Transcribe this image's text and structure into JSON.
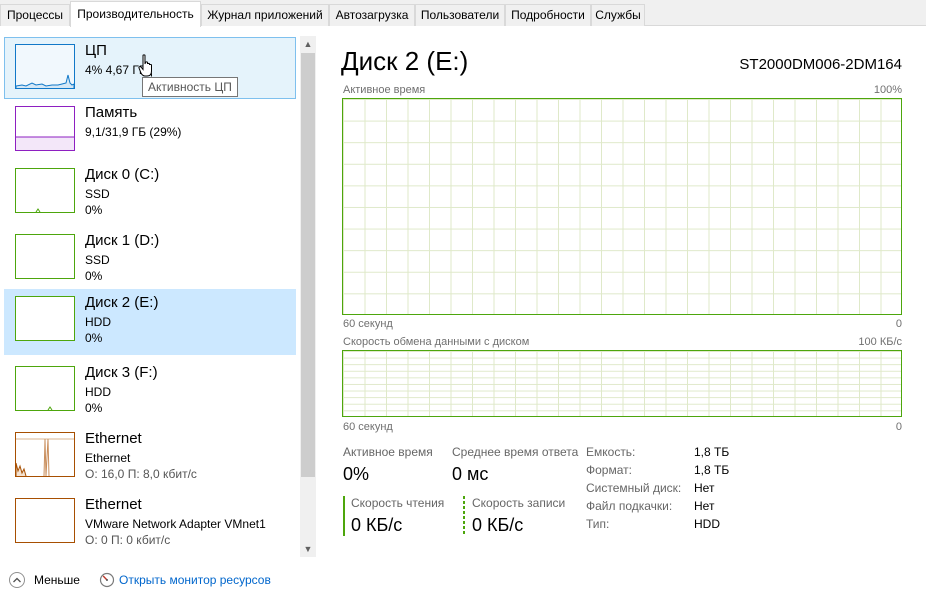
{
  "tabs": [
    "Процессы",
    "Производительность",
    "Журнал приложений",
    "Автозагрузка",
    "Пользователи",
    "Подробности",
    "Службы"
  ],
  "active_tab": "Производительность",
  "sidebar": {
    "items": [
      {
        "title": "ЦП",
        "line1": "4% 4,67 ГГц",
        "line2": "",
        "color": "#1178c8",
        "state": "hover"
      },
      {
        "title": "Память",
        "line1": "9,1/31,9 ГБ (29%)",
        "line2": "",
        "color": "#8e1fc1",
        "state": "normal"
      },
      {
        "title": "Диск 0 (C:)",
        "line1": "SSD",
        "line2": "0%",
        "color": "#4da60c",
        "state": "normal"
      },
      {
        "title": "Диск 1 (D:)",
        "line1": "SSD",
        "line2": "0%",
        "color": "#4da60c",
        "state": "normal"
      },
      {
        "title": "Диск 2 (E:)",
        "line1": "HDD",
        "line2": "0%",
        "color": "#4da60c",
        "state": "selected"
      },
      {
        "title": "Диск 3 (F:)",
        "line1": "HDD",
        "line2": "0%",
        "color": "#4da60c",
        "state": "normal"
      },
      {
        "title": "Ethernet",
        "line1": "Ethernet",
        "line2": "О: 16,0 П: 8,0 кбит/с",
        "color": "#a74f01",
        "state": "normal"
      },
      {
        "title": "Ethernet",
        "line1": "VMware Network Adapter VMnet1",
        "line2": "О: 0 П: 0 кбит/с",
        "color": "#a74f01",
        "state": "normal"
      }
    ]
  },
  "tooltip": "Активность ЦП",
  "main": {
    "title": "Диск 2 (E:)",
    "model": "ST2000DM006-2DM164",
    "graph1": {
      "label": "Активное время",
      "max": "100%",
      "time": "60 секунд",
      "min": "0"
    },
    "graph2": {
      "label": "Скорость обмена данными с диском",
      "max": "100 КБ/с",
      "time": "60 секунд",
      "min": "0"
    },
    "stats": {
      "active_label": "Активное время",
      "active_value": "0%",
      "response_label": "Среднее время ответа",
      "response_value": "0 мс",
      "read_label": "Скорость чтения",
      "read_value": "0 КБ/с",
      "write_label": "Скорость записи",
      "write_value": "0 КБ/с"
    },
    "props": [
      {
        "label": "Емкость:",
        "value": "1,8 ТБ"
      },
      {
        "label": "Формат:",
        "value": "1,8 ТБ"
      },
      {
        "label": "Системный диск:",
        "value": "Нет"
      },
      {
        "label": "Файл подкачки:",
        "value": "Нет"
      },
      {
        "label": "Тип:",
        "value": "HDD"
      }
    ]
  },
  "footer": {
    "less": "Меньше",
    "link": "Открыть монитор ресурсов"
  },
  "colors": {
    "disk": "#4da60c",
    "cpu": "#1178c8",
    "memory": "#8e1fc1",
    "ethernet": "#a74f01",
    "selected": "#cce8ff",
    "hover": "#e5f3fb",
    "link": "#0066cc"
  },
  "icons": [
    "chevron-up-icon",
    "resource-monitor-icon",
    "hand-cursor-icon",
    "scroll-up-icon",
    "scroll-down-icon"
  ]
}
